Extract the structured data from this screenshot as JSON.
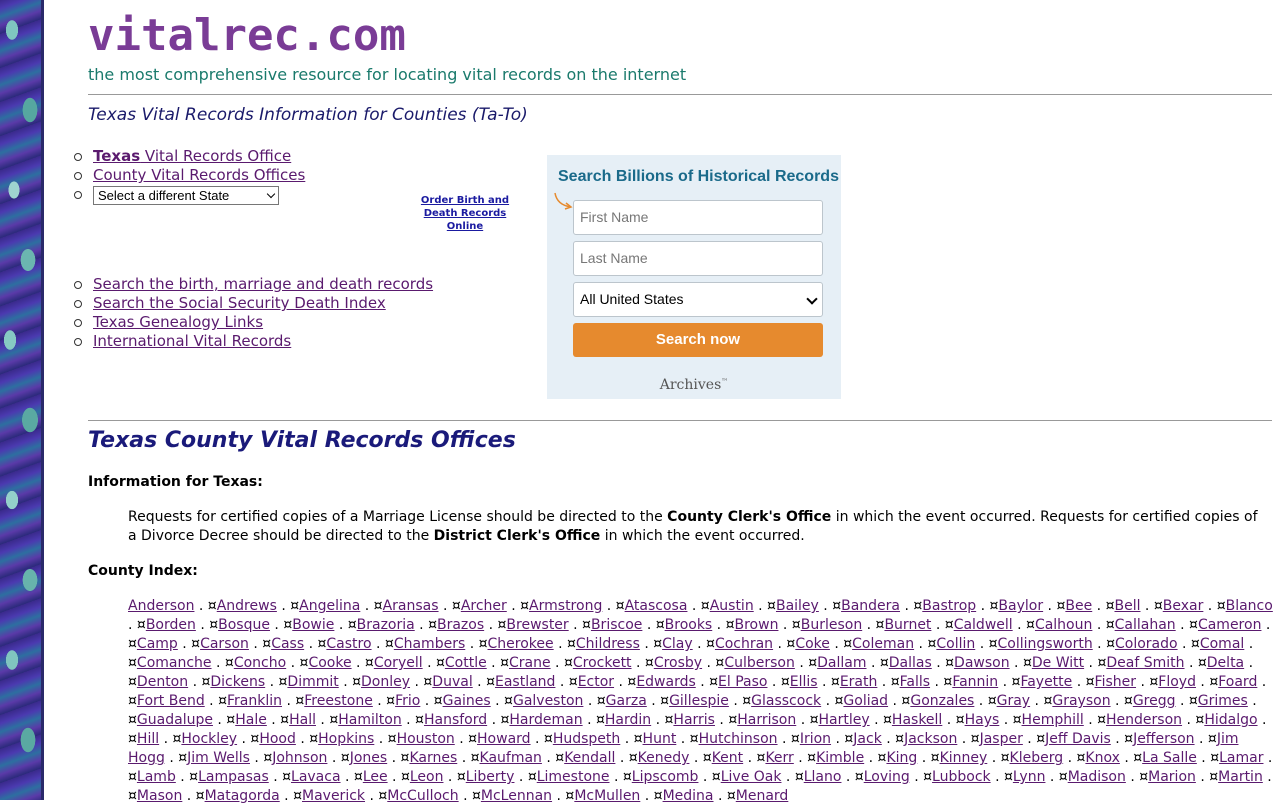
{
  "header": {
    "logo": "vitalrec.com",
    "tagline": "the most comprehensive resource for locating vital records on the internet",
    "page_heading": "Texas Vital Records Information for Counties (Ta-To)"
  },
  "nav_top": {
    "state_office_bold": "Texas",
    "state_office_rest": " Vital Records Office",
    "county_offices": "County Vital Records Offices",
    "select_state": "Select a different State"
  },
  "order_link": {
    "line1": "Order Birth and",
    "line2": "Death Records Online"
  },
  "nav_bottom": [
    "Search the birth, marriage and death records",
    "Search the Social Security Death Index",
    "Texas Genealogy Links",
    "International Vital Records"
  ],
  "search_widget": {
    "title": "Search Billions of Historical Records",
    "first_name_placeholder": "First Name",
    "last_name_placeholder": "Last Name",
    "region_value": "All United States",
    "button_label": "Search now",
    "brand": "Archives",
    "brand_tm": "™",
    "accent_color": "#e68a2e",
    "title_color": "#1a6a8a"
  },
  "section": {
    "title": "Texas County Vital Records Offices",
    "info_label": "Information for Texas:",
    "info_p1": "Requests for certified copies of a Marriage License should be directed to the ",
    "info_b1": "County Clerk's Office",
    "info_p2": " in which the event occurred. Requests for certified copies of a Divorce Decree should be directed to the ",
    "info_b2": "District Clerk's Office",
    "info_p3": " in which the event occurred.",
    "index_label": "County Index:"
  },
  "counties": [
    "Anderson",
    "Andrews",
    "Angelina",
    "Aransas",
    "Archer",
    "Armstrong",
    "Atascosa",
    "Austin",
    "Bailey",
    "Bandera",
    "Bastrop",
    "Baylor",
    "Bee",
    "Bell",
    "Bexar",
    "Blanco",
    "Borden",
    "Bosque",
    "Bowie",
    "Brazoria",
    "Brazos",
    "Brewster",
    "Briscoe",
    "Brooks",
    "Brown",
    "Burleson",
    "Burnet",
    "Caldwell",
    "Calhoun",
    "Callahan",
    "Cameron",
    "Camp",
    "Carson",
    "Cass",
    "Castro",
    "Chambers",
    "Cherokee",
    "Childress",
    "Clay",
    "Cochran",
    "Coke",
    "Coleman",
    "Collin",
    "Collingsworth",
    "Colorado",
    "Comal",
    "Comanche",
    "Concho",
    "Cooke",
    "Coryell",
    "Cottle",
    "Crane",
    "Crockett",
    "Crosby",
    "Culberson",
    "Dallam",
    "Dallas",
    "Dawson",
    "De Witt",
    "Deaf Smith",
    "Delta",
    "Denton",
    "Dickens",
    "Dimmit",
    "Donley",
    "Duval",
    "Eastland",
    "Ector",
    "Edwards",
    "El Paso",
    "Ellis",
    "Erath",
    "Falls",
    "Fannin",
    "Fayette",
    "Fisher",
    "Floyd",
    "Foard",
    "Fort Bend",
    "Franklin",
    "Freestone",
    "Frio",
    "Gaines",
    "Galveston",
    "Garza",
    "Gillespie",
    "Glasscock",
    "Goliad",
    "Gonzales",
    "Gray",
    "Grayson",
    "Gregg",
    "Grimes",
    "Guadalupe",
    "Hale",
    "Hall",
    "Hamilton",
    "Hansford",
    "Hardeman",
    "Hardin",
    "Harris",
    "Harrison",
    "Hartley",
    "Haskell",
    "Hays",
    "Hemphill",
    "Henderson",
    "Hidalgo",
    "Hill",
    "Hockley",
    "Hood",
    "Hopkins",
    "Houston",
    "Howard",
    "Hudspeth",
    "Hunt",
    "Hutchinson",
    "Irion",
    "Jack",
    "Jackson",
    "Jasper",
    "Jeff Davis",
    "Jefferson",
    "Jim Hogg",
    "Jim Wells",
    "Johnson",
    "Jones",
    "Karnes",
    "Kaufman",
    "Kendall",
    "Kenedy",
    "Kent",
    "Kerr",
    "Kimble",
    "King",
    "Kinney",
    "Kleberg",
    "Knox",
    "La Salle",
    "Lamar",
    "Lamb",
    "Lampasas",
    "Lavaca",
    "Lee",
    "Leon",
    "Liberty",
    "Limestone",
    "Lipscomb",
    "Live Oak",
    "Llano",
    "Loving",
    "Lubbock",
    "Lynn",
    "Madison",
    "Marion",
    "Martin",
    "Mason",
    "Matagorda",
    "Maverick",
    "McCulloch",
    "McLennan",
    "McMullen",
    "Medina",
    "Menard"
  ]
}
